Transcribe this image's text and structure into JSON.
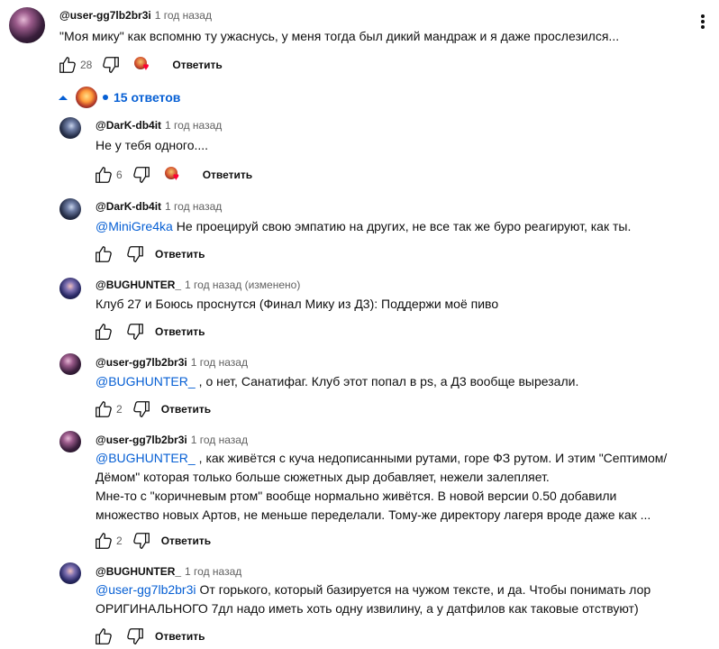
{
  "top_comment": {
    "author": "@user-gg7lb2br3i",
    "time": "1 год назад",
    "text": "\"Моя мику\" как вспомню ту ужаснусь, у меня тогда был дикий мандраж и я даже прослезился...",
    "likes": "28",
    "reply_label": "Ответить",
    "replies_label": "15 ответов"
  },
  "replies": [
    {
      "author": "@DarK-db4it",
      "time": "1 год назад",
      "mention": "",
      "text": "Не у тебя одного....",
      "likes": "6",
      "reply_label": "Ответить",
      "creator_heart": true
    },
    {
      "author": "@DarK-db4it",
      "time": "1 год назад",
      "mention": "@MiniGre4ka",
      "text": "Не проецируй свою эмпатию на других, не все так же буро реагируют, как ты.",
      "likes": "",
      "reply_label": "Ответить",
      "creator_heart": false
    },
    {
      "author": "@BUGHUNTER_",
      "time": "1 год назад (изменено)",
      "mention": "",
      "text": "Клуб 27 и Боюсь проснутся (Финал Мику из Д3): Поддержи моё пиво",
      "likes": "",
      "reply_label": "Ответить",
      "creator_heart": false
    },
    {
      "author": "@user-gg7lb2br3i",
      "time": "1 год назад",
      "mention": "@BUGHUNTER_",
      "text": ", о нет, Санатифаг. Клуб этот попал в ps, а Д3 вообще вырезали.",
      "likes": "2",
      "reply_label": "Ответить",
      "creator_heart": false
    },
    {
      "author": "@user-gg7lb2br3i",
      "time": "1 год назад",
      "mention": "@BUGHUNTER_",
      "text": ", как живётся с куча недописанными рутами, горе ФЗ рутом. И этим \"Септимом/Дёмом\" которая только больше сюжетных дыр добавляет, нежели залепляет.",
      "text2": "Мне-то с \"коричневым ртом\" вообще нормально живётся. В новой версии 0.50 добавили множество новых Артов, не меньше переделали. Тому-же директору лагеря вроде даже как ...",
      "likes": "2",
      "reply_label": "Ответить",
      "creator_heart": false
    },
    {
      "author": "@BUGHUNTER_",
      "time": "1 год назад",
      "mention": "@user-gg7lb2br3i",
      "text": "От горького, который базируется на чужом тексте, и да. Чтобы понимать лор ОРИГИНАЛЬНОГО 7дл надо иметь хоть одну извилину, а у датфилов как таковые отствуют)",
      "likes": "",
      "reply_label": "Ответить",
      "creator_heart": false
    }
  ],
  "icons": {
    "like": "thumb-up-icon",
    "dislike": "thumb-down-icon",
    "more": "vertical-dots-icon",
    "toggle": "chevron-up-icon"
  },
  "colors": {
    "link": "#065fd4",
    "heart": "#ff0033",
    "secondary_text": "#606060"
  }
}
